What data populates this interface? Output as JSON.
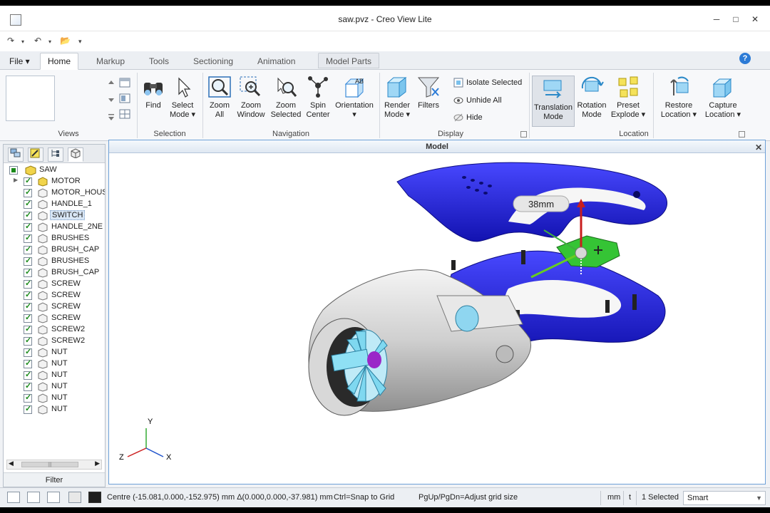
{
  "window": {
    "title": "saw.pvz - Creo View Lite",
    "minimize": "─",
    "maximize": "□",
    "close": "✕"
  },
  "quick_access": {
    "redo": "↷",
    "undo": "↶",
    "open": "📂",
    "more": "▾"
  },
  "tabs": [
    {
      "label": "File ▾",
      "name": "file"
    },
    {
      "label": "Home",
      "name": "home"
    },
    {
      "label": "Markup",
      "name": "markup"
    },
    {
      "label": "Tools",
      "name": "tools"
    },
    {
      "label": "Sectioning",
      "name": "sectioning"
    },
    {
      "label": "Animation",
      "name": "animation"
    },
    {
      "label": "Model Parts",
      "name": "model-parts"
    }
  ],
  "help": "?",
  "ribbon": {
    "groups": {
      "views": "Views",
      "selection": "Selection",
      "navigation": "Navigation",
      "display": "Display",
      "location": "Location"
    },
    "selection": {
      "find": "Find",
      "select_mode_1": "Select",
      "select_mode_2": "Mode ▾"
    },
    "navigation": {
      "zoom_all_1": "Zoom",
      "zoom_all_2": "All",
      "zoom_window_1": "Zoom",
      "zoom_window_2": "Window",
      "zoom_selected_1": "Zoom",
      "zoom_selected_2": "Selected",
      "spin_center_1": "Spin",
      "spin_center_2": "Center",
      "orientation_1": "Orientation",
      "orientation_2": "▾"
    },
    "display": {
      "render_mode_1": "Render",
      "render_mode_2": "Mode ▾",
      "filters": "Filters",
      "isolate_selected": "Isolate Selected",
      "unhide_all": "Unhide All",
      "hide": "Hide"
    },
    "location": {
      "translation_mode_1": "Translation",
      "translation_mode_2": "Mode",
      "rotation_mode_1": "Rotation",
      "rotation_mode_2": "Mode",
      "preset_explode_1": "Preset",
      "preset_explode_2": "Explode ▾",
      "restore_location_1": "Restore",
      "restore_location_2": "Location ▾",
      "capture_location_1": "Capture",
      "capture_location_2": "Location ▾"
    }
  },
  "tree": {
    "root": "SAW",
    "items": [
      {
        "label": "MOTOR",
        "expandable": true
      },
      {
        "label": "MOTOR_HOUSING",
        "expandable": false
      },
      {
        "label": "HANDLE_1",
        "expandable": false
      },
      {
        "label": "SWITCH",
        "expandable": false,
        "selected": true
      },
      {
        "label": "HANDLE_2NE",
        "expandable": false
      },
      {
        "label": "BRUSHES",
        "expandable": false
      },
      {
        "label": "BRUSH_CAP",
        "expandable": false
      },
      {
        "label": "BRUSHES",
        "expandable": false
      },
      {
        "label": "BRUSH_CAP",
        "expandable": false
      },
      {
        "label": "SCREW",
        "expandable": false
      },
      {
        "label": "SCREW",
        "expandable": false
      },
      {
        "label": "SCREW",
        "expandable": false
      },
      {
        "label": "SCREW",
        "expandable": false
      },
      {
        "label": "SCREW2",
        "expandable": false
      },
      {
        "label": "SCREW2",
        "expandable": false
      },
      {
        "label": "NUT",
        "expandable": false
      },
      {
        "label": "NUT",
        "expandable": false
      },
      {
        "label": "NUT",
        "expandable": false
      },
      {
        "label": "NUT",
        "expandable": false
      },
      {
        "label": "NUT",
        "expandable": false
      },
      {
        "label": "NUT",
        "expandable": false
      }
    ],
    "filter": "Filter",
    "scroll_grip": "|||"
  },
  "viewport": {
    "title": "Model",
    "close": "✕",
    "dimension_label": "38mm",
    "axis_x": "X",
    "axis_y": "Y",
    "axis_z": "Z"
  },
  "status": {
    "coords": "Centre (-15.081,0.000,-152.975) mm Δ(0.000,0.000,-37.981) mm",
    "snap_hint": "Ctrl=Snap to Grid",
    "grid_hint": "PgUp/PgDn=Adjust grid size",
    "unit": "mm",
    "t": "t",
    "selected": "1 Selected",
    "select_filter": "Smart"
  },
  "colors": {
    "housing_blue": "#1f1fd6",
    "switch_green": "#35c435",
    "motor_grey": "#d6d6d6",
    "fan_cyan": "#7fd8f0",
    "accent": "#2c7bd6"
  }
}
